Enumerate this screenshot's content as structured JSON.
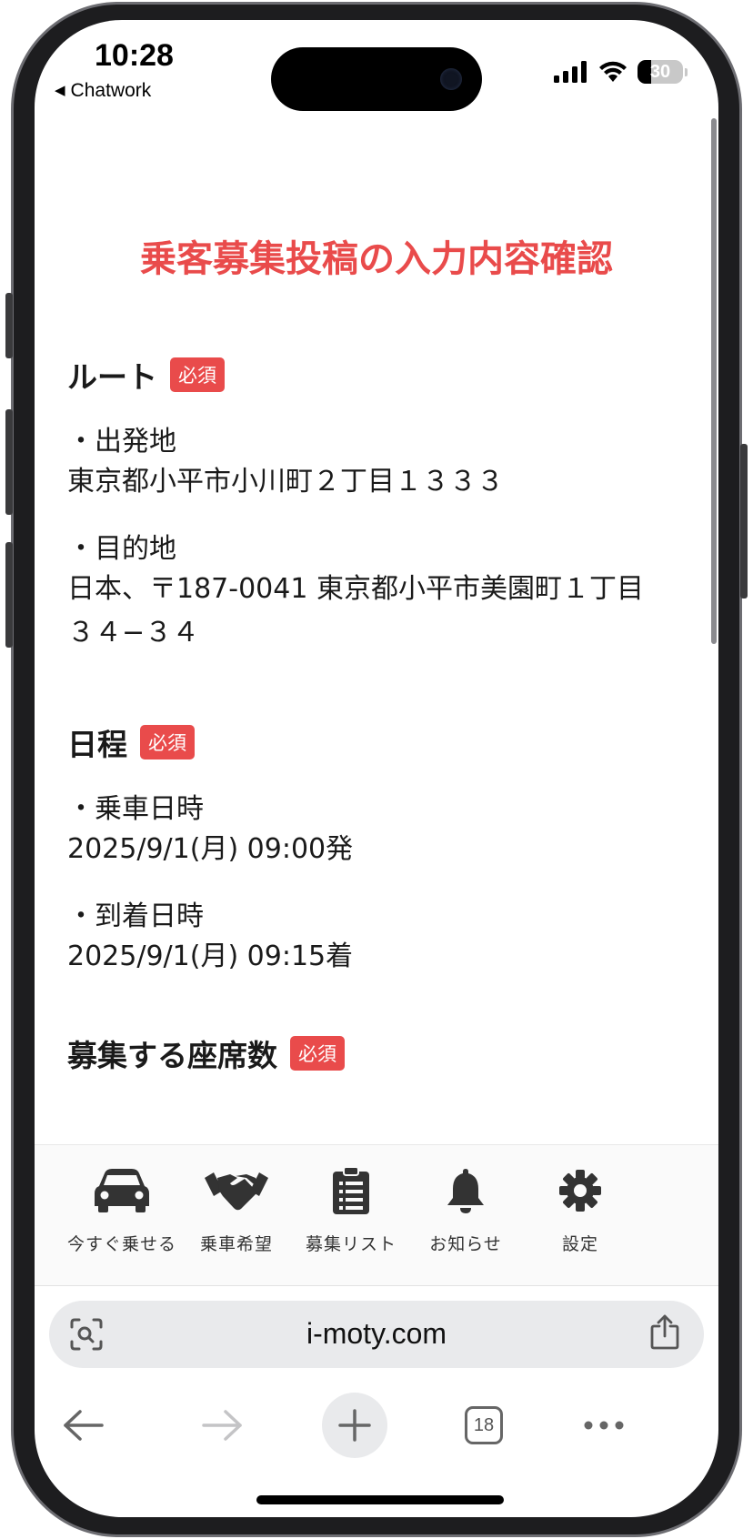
{
  "status": {
    "time": "10:28",
    "back_app": "Chatwork",
    "battery": "30"
  },
  "page": {
    "title": "乗客募集投稿の入力内容確認",
    "required_badge": "必須"
  },
  "sections": {
    "route": {
      "heading": "ルート",
      "origin_label": "・出発地",
      "origin_value": "東京都小平市小川町２丁目１３３３",
      "dest_label": "・目的地",
      "dest_value": "日本、〒187-0041 東京都小平市美園町１丁目３４−３４"
    },
    "schedule": {
      "heading": "日程",
      "board_label": "・乗車日時",
      "board_value": "2025/9/1(月) 09:00発",
      "arrive_label": "・到着日時",
      "arrive_value": "2025/9/1(月) 09:15着"
    },
    "seats": {
      "heading": "募集する座席数"
    }
  },
  "tabbar": {
    "items": [
      {
        "label": "今すぐ乗せる",
        "icon": "car-icon"
      },
      {
        "label": "乗車希望",
        "icon": "handshake-icon"
      },
      {
        "label": "募集リスト",
        "icon": "clipboard-icon"
      },
      {
        "label": "お知らせ",
        "icon": "bell-icon"
      },
      {
        "label": "設定",
        "icon": "gear-icon"
      }
    ]
  },
  "browser": {
    "url": "i-moty.com",
    "tab_count": "18"
  },
  "colors": {
    "accent": "#e94b4b",
    "tab_icon": "#333333"
  }
}
